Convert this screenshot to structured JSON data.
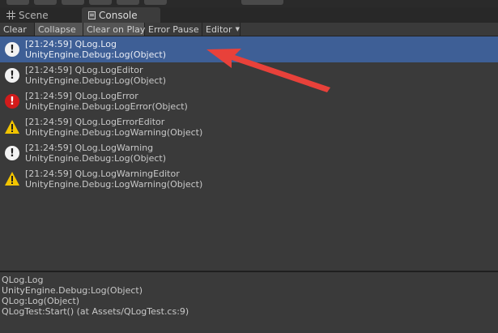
{
  "tabs": [
    {
      "label": "Scene",
      "icon": "grid-icon"
    },
    {
      "label": "Console",
      "icon": "console-icon"
    }
  ],
  "toolbar": {
    "clear": "Clear",
    "collapse": "Collapse",
    "clear_on_play": "Clear on Play",
    "error_pause": "Error Pause",
    "editor": "Editor",
    "collapse_on": true,
    "clear_on_play_on": true
  },
  "logs": [
    {
      "line1": "[21:24:59] QLog.Log",
      "line2": "UnityEngine.Debug:Log(Object)",
      "level": "info",
      "selected": true
    },
    {
      "line1": "[21:24:59] QLog.LogEditor",
      "line2": "UnityEngine.Debug:Log(Object)",
      "level": "info",
      "selected": false
    },
    {
      "line1": "[21:24:59] QLog.LogError",
      "line2": "UnityEngine.Debug:LogError(Object)",
      "level": "error",
      "selected": false
    },
    {
      "line1": "[21:24:59] QLog.LogErrorEditor",
      "line2": "UnityEngine.Debug:LogWarning(Object)",
      "level": "warning",
      "selected": false
    },
    {
      "line1": "[21:24:59] QLog.LogWarning",
      "line2": "UnityEngine.Debug:Log(Object)",
      "level": "info",
      "selected": false
    },
    {
      "line1": "[21:24:59] QLog.LogWarningEditor",
      "line2": "UnityEngine.Debug:LogWarning(Object)",
      "level": "warning",
      "selected": false
    }
  ],
  "details": [
    "QLog.Log",
    "UnityEngine.Debug:Log(Object)",
    "QLog:Log(Object)",
    "QLogTest:Start() (at Assets/QLogTest.cs:9)"
  ],
  "colors": {
    "selection": "#3e5f96",
    "error": "#d21b1b",
    "warning": "#f2c400",
    "arrow": "#e8413a"
  }
}
